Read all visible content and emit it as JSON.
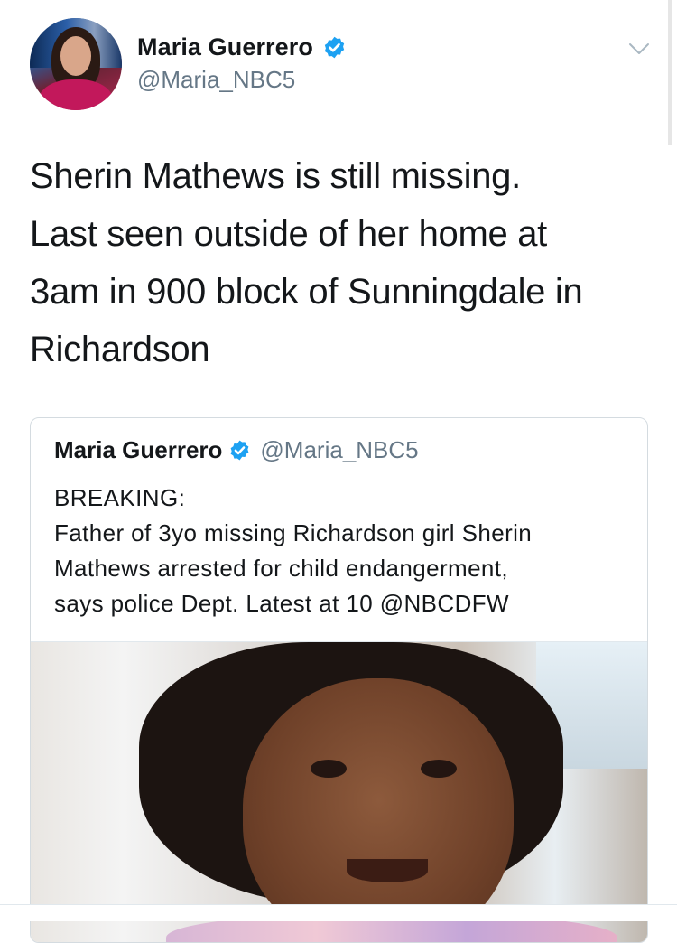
{
  "tweet": {
    "author": {
      "display_name": "Maria Guerrero",
      "handle": "@Maria_NBC5",
      "verified": true
    },
    "text": "Sherin Mathews is still missing.\nLast seen outside of her home at\n3am in 900 block of Sunningdale in\nRichardson"
  },
  "quoted_tweet": {
    "author": {
      "display_name": "Maria Guerrero",
      "handle": "@Maria_NBC5",
      "verified": true
    },
    "text": "BREAKING:\nFather of 3yo missing Richardson girl Sherin\nMathews arrested for child endangerment,\nsays police Dept. Latest at 10 @NBCDFW",
    "media": "photo"
  },
  "icons": {
    "verified": "verified-badge-icon",
    "menu": "chevron-down-icon"
  },
  "colors": {
    "verified_blue": "#1da1f2",
    "secondary_text": "#657786",
    "primary_text": "#14171a",
    "border": "#d4dbe0"
  }
}
